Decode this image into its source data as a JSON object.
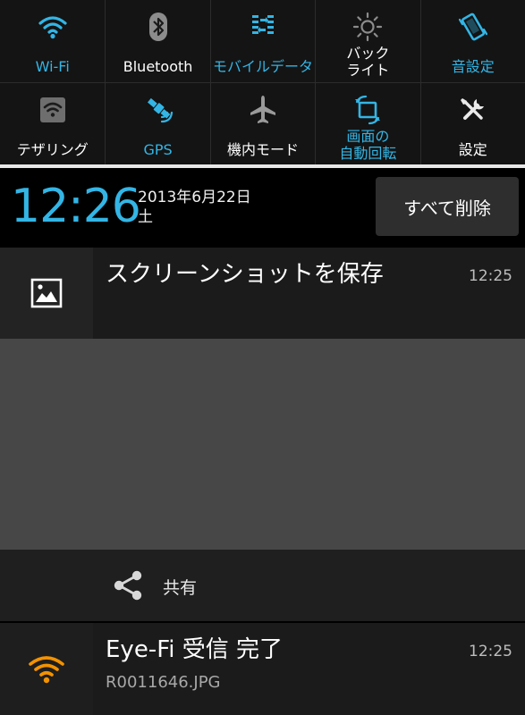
{
  "quick_settings": {
    "row1": [
      {
        "label": "Wi-Fi",
        "state": "on"
      },
      {
        "label": "Bluetooth",
        "state": "off"
      },
      {
        "label": "モバイルデータ",
        "state": "on"
      },
      {
        "label": "バック\nライト",
        "state": "off"
      },
      {
        "label": "音設定",
        "state": "on"
      }
    ],
    "row2": [
      {
        "label": "テザリング",
        "state": "off"
      },
      {
        "label": "GPS",
        "state": "on"
      },
      {
        "label": "機内モード",
        "state": "off"
      },
      {
        "label": "画面の\n自動回転",
        "state": "on"
      },
      {
        "label": "設定",
        "state": "off"
      }
    ]
  },
  "header": {
    "time": "12:26",
    "date_line1": "2013年6月22日",
    "date_line2": "土",
    "clear_all_label": "すべて削除"
  },
  "notifications": [
    {
      "title": "スクリーンショットを保存",
      "time": "12:25",
      "icon": "image-icon",
      "action": {
        "label": "共有",
        "icon": "share-icon"
      }
    },
    {
      "title": "Eye-Fi 受信 完了",
      "subtitle": "R0011646.JPG",
      "time": "12:25",
      "icon": "wifi-orange-icon"
    }
  ],
  "colors": {
    "accent": "#33b5e5",
    "inactive_icon": "#aaaaaa",
    "eyefi_orange": "#f39200",
    "panel_bg": "#141414",
    "preview_bg": "#474747"
  }
}
